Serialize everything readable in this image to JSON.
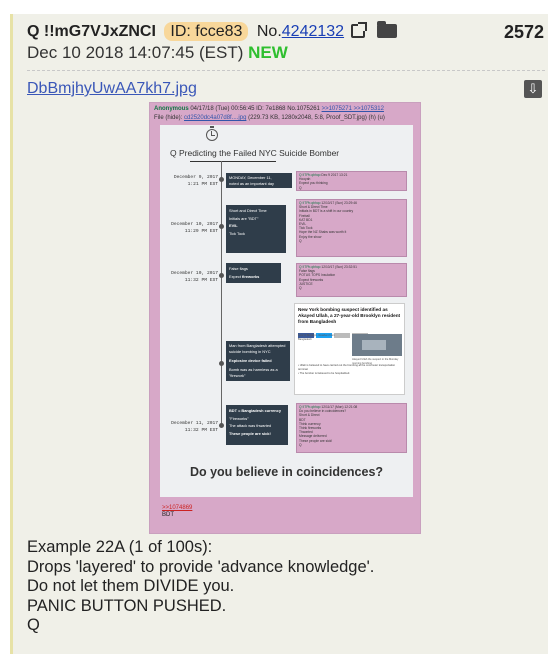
{
  "header": {
    "author": "Q !!mG7VJxZNCI",
    "id_badge": "ID: fcce83",
    "number_prefix": "No.",
    "number": "4242132",
    "timestamp": "Dec 10 2018 14:07:45 (EST)",
    "new_badge": "NEW",
    "post_index": "2572"
  },
  "file": {
    "name": "DbBmjhyUwAA7kh7.jpg",
    "download_icon": "download-icon"
  },
  "screenshot": {
    "meta_anon": "Anonymous",
    "meta_line": "04/17/18 (Tue) 00:56:45 ID: 7e1868 No.1075261",
    "meta_refs": ">>1075271 >>1075312",
    "file_line": "File (hide):",
    "file_ref": "cd2520dc4a07d8f....jpg",
    "file_info": "(229.73 KB, 1280x2048, 5:8, Proof_SDT.jpg) (h) (u)",
    "timeline_title": "Q Predicting the Failed NYC Suicide Bomber",
    "events": [
      {
        "date1": "December 9, 2017",
        "date2": "1:21 PM EST",
        "lines": [
          "MONDAY, December 11,",
          "noted as an important day"
        ]
      },
      {
        "date1": "December 10, 2017",
        "date2": "11:29 PM EST",
        "lines": [
          "Short and Direct Time",
          "Initials are \"BDT\"",
          "EVIL",
          "Tick Tock"
        ]
      },
      {
        "date1": "December 10, 2017",
        "date2": "11:32 PM EST",
        "lines": [
          "False flags",
          "Expect fireworks"
        ]
      },
      {
        "lines": [
          "Man from Bangladesh attempted",
          "suicide bombing in NYC",
          "Explosive device failed",
          "Bomb was as harmless as a",
          "\"firework\""
        ]
      },
      {
        "date1": "December 11, 2017",
        "date2": "11:32 PM EST",
        "lines": [
          "BDT = Bangladesh currency",
          "\"Fireworks\"",
          "The attack was thwarted",
          "These people are sick!"
        ]
      }
    ],
    "posts": [
      [
        "Q !ITPb.qbhqo",
        "Dec 9 2017 13:21",
        "Hooyah",
        "Expect you thinking",
        "Q"
      ],
      [
        "Q !ITPb.qbhqo",
        "12/10/17 (Sun) 23:29:46",
        "Short & Direct Time",
        "Initials in BDT is a shift in our country",
        "Fireball",
        "KAT BD1",
        "EVIL",
        "Tick Tock",
        "Hope the NZ Shabs was worth it",
        "Enjoy the show",
        "Q"
      ],
      [
        "Q !ITPb.qbhqo",
        "12/10/17 (Sun) 23:32:51",
        "False flags",
        "POTUS TOPS Insulation",
        "Expect fireworks",
        "JUSTICE",
        "Q"
      ],
      [
        "Q !ITPb.qbhqo",
        "12/11/17 (Mon) 12:21:08",
        "Do you believe in coincidences?",
        "Short & Direct",
        "BDT",
        "Think currency",
        "Think fireworks",
        "Thwarted",
        "Message delivered",
        "These people are sick!",
        "Q"
      ]
    ],
    "news": {
      "headline": "New York bombing suspect identified as Akayed Ullah, a 27-year-old Brooklyn resident from Bangladesh",
      "article": "Four of Brooklyn. Resident from Bangladesh",
      "caption": "Akayed Ullah the suspect in the Monday morning bombing",
      "bullets": [
        "Ullah is believed to have carried out the bombing at the commuter transportation terminal.",
        "The bomber is believed to be hospitalized."
      ]
    },
    "closing": "Do you believe in coincidences?",
    "bottom_ref": ">>1074869",
    "bottom_text": "BDT"
  },
  "body_lines": [
    "Example 22A (1 of 100s):",
    "Drops 'layered' to provide 'advance knowledge'.",
    "Do not let them DIVIDE you.",
    "PANIC BUTTON PUSHED.",
    "Q"
  ]
}
